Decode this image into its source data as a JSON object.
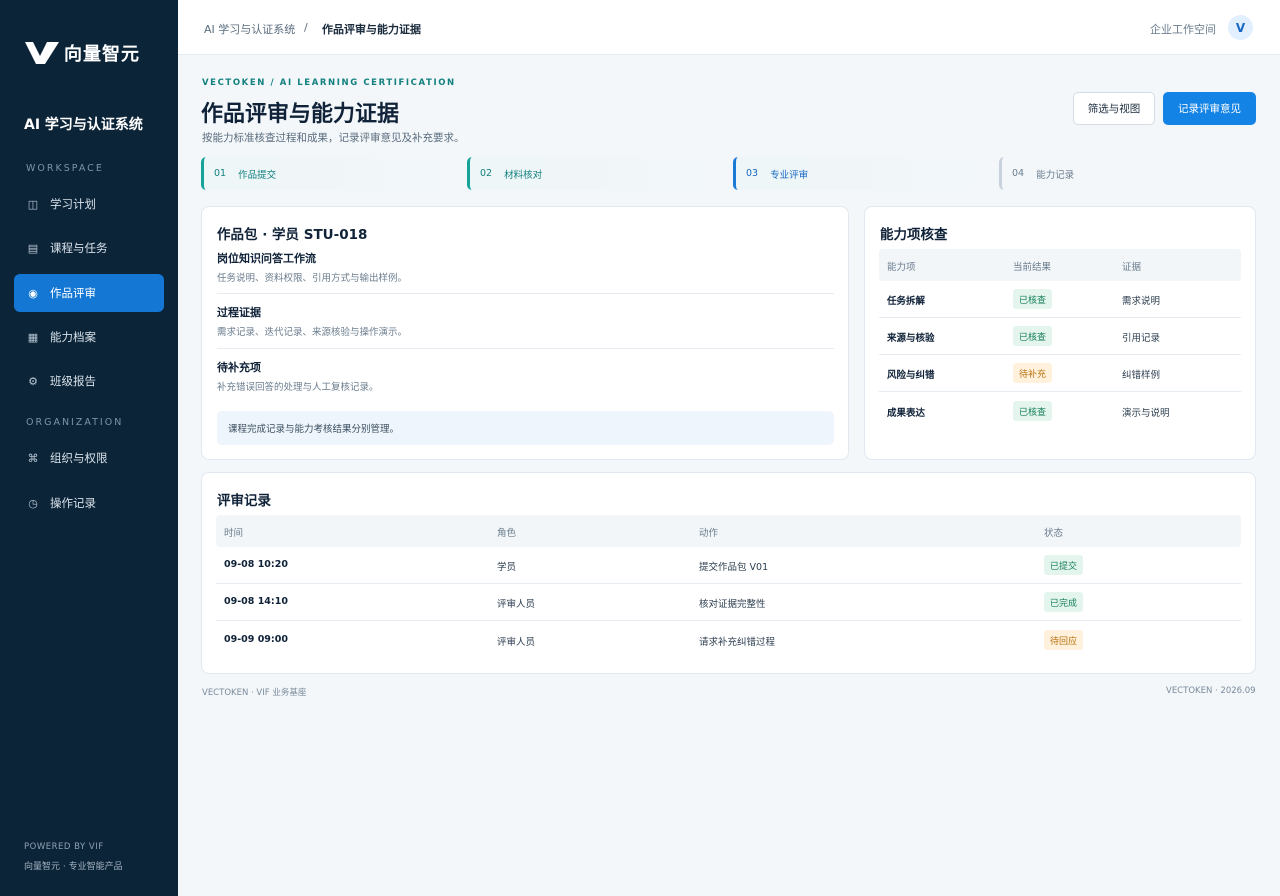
{
  "brand": {
    "name": "向量智元"
  },
  "sidebar": {
    "system_title": "AI 学习与认证系统",
    "workspace_label": "WORKSPACE",
    "organization_label": "ORGANIZATION",
    "workspace_items": [
      {
        "label": "学习计划",
        "icon": "columns-icon"
      },
      {
        "label": "课程与任务",
        "icon": "list-icon"
      },
      {
        "label": "作品评审",
        "icon": "dot-icon",
        "active": true
      },
      {
        "label": "能力档案",
        "icon": "grid-icon"
      },
      {
        "label": "班级报告",
        "icon": "gear-icon"
      }
    ],
    "organization_items": [
      {
        "label": "组织与权限",
        "icon": "command-icon"
      },
      {
        "label": "操作记录",
        "icon": "clock-icon"
      }
    ],
    "footer_line1": "POWERED BY VIF",
    "footer_line2": "向量智元 · 专业智能产品"
  },
  "topbar": {
    "breadcrumb_root": "AI 学习与认证系统",
    "breadcrumb_sep": "/",
    "breadcrumb_current": "作品评审与能力证据",
    "workspace": "企业工作空间",
    "avatar": "V"
  },
  "header": {
    "eyebrow": "VECTOKEN / AI LEARNING CERTIFICATION",
    "title": "作品评审与能力证据",
    "subtitle": "按能力标准核查过程和成果，记录评审意见及补充要求。",
    "filter_button": "筛选与视图",
    "primary_button": "记录评审意见"
  },
  "steps": [
    {
      "num": "01",
      "label": "作品提交"
    },
    {
      "num": "02",
      "label": "材料核对"
    },
    {
      "num": "03",
      "label": "专业评审"
    },
    {
      "num": "04",
      "label": "能力记录"
    }
  ],
  "package": {
    "title": "作品包 · 学员 STU-018",
    "items": [
      {
        "title": "岗位知识问答工作流",
        "desc": "任务说明、资料权限、引用方式与输出样例。"
      },
      {
        "title": "过程证据",
        "desc": "需求记录、迭代记录、来源核验与操作演示。"
      },
      {
        "title": "待补充项",
        "desc": "补充错误回答的处理与人工复核记录。"
      }
    ],
    "note": "课程完成记录与能力考核结果分别管理。"
  },
  "ability": {
    "title": "能力项核查",
    "headers": [
      "能力项",
      "当前结果",
      "证据"
    ],
    "rows": [
      {
        "name": "任务拆解",
        "result": "已核查",
        "status": "ok",
        "evidence": "需求说明"
      },
      {
        "name": "来源与核验",
        "result": "已核查",
        "status": "ok",
        "evidence": "引用记录"
      },
      {
        "name": "风险与纠错",
        "result": "待补充",
        "status": "warn",
        "evidence": "纠错样例"
      },
      {
        "name": "成果表达",
        "result": "已核查",
        "status": "ok",
        "evidence": "演示与说明"
      }
    ]
  },
  "review": {
    "title": "评审记录",
    "headers": [
      "时间",
      "角色",
      "动作",
      "状态"
    ],
    "rows": [
      {
        "time": "09-08 10:20",
        "role": "学员",
        "action": "提交作品包 V01",
        "status": "已提交",
        "tone": "ok"
      },
      {
        "time": "09-08 14:10",
        "role": "评审人员",
        "action": "核对证据完整性",
        "status": "已完成",
        "tone": "ok"
      },
      {
        "time": "09-09 09:00",
        "role": "评审人员",
        "action": "请求补充纠错过程",
        "status": "待回应",
        "tone": "warn"
      }
    ]
  },
  "page_footer": {
    "left": "VECTOKEN · VIF 业务基座",
    "right": "VECTOKEN · 2026.09"
  },
  "colors": {
    "sidebar_bg": "#0c2438",
    "accent": "#1483e6",
    "teal": "#12807f",
    "ok": "#168058",
    "warn": "#b9720e"
  }
}
